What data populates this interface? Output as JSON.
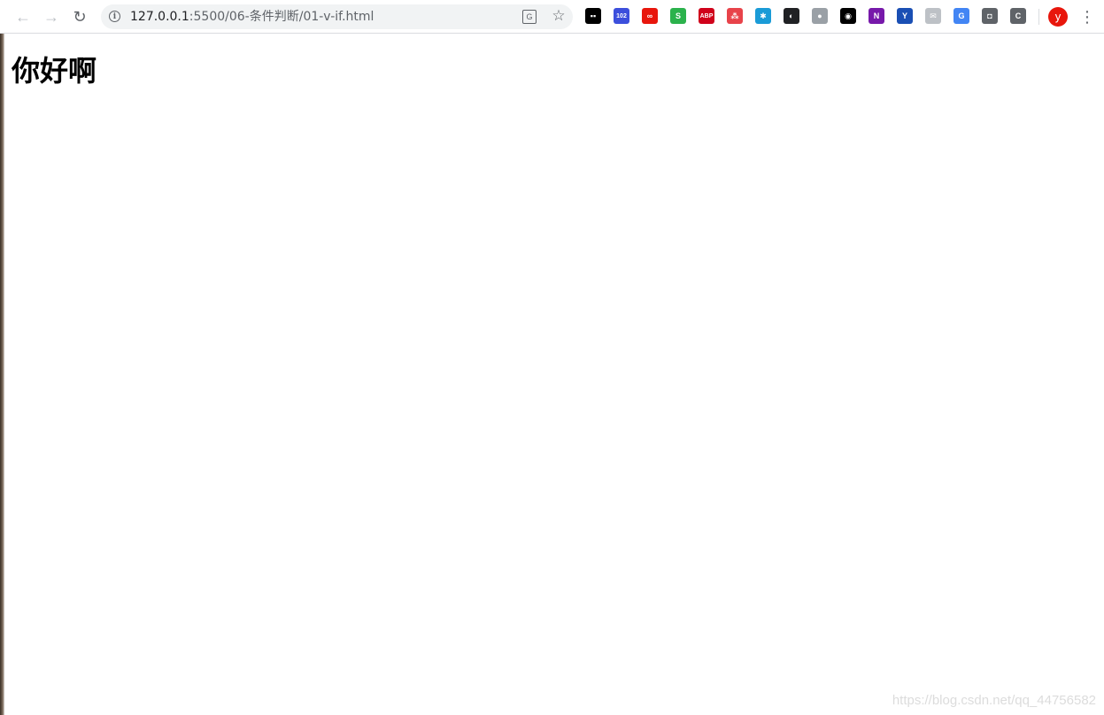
{
  "toolbar": {
    "back_icon": "←",
    "forward_icon": "→",
    "reload_icon": "↻",
    "url_host": "127.0.0.1",
    "url_rest": ":5500/06-条件判断/01-v-if.html",
    "info_icon": "i",
    "translate_icon": "G",
    "star_icon": "☆",
    "avatar_letter": "y",
    "menu_icon": "⋮"
  },
  "extensions": [
    {
      "name": "tampermonkey-icon",
      "glyph": "▪▪",
      "color": "#000000"
    },
    {
      "name": "mail-counter-icon",
      "glyph": "102",
      "color": "#3c4fdc"
    },
    {
      "name": "infinity-icon",
      "glyph": "∞",
      "color": "#e8160c"
    },
    {
      "name": "s-extension-icon",
      "glyph": "S",
      "color": "#2bb24c"
    },
    {
      "name": "adblock-icon",
      "glyph": "ABP",
      "color": "#d0021b"
    },
    {
      "name": "tree-extension-icon",
      "glyph": "⁂",
      "color": "#e8434a"
    },
    {
      "name": "asterisk-icon",
      "glyph": "✱",
      "color": "#1a9bd7"
    },
    {
      "name": "dark-reader-icon",
      "glyph": "◐",
      "color": "#202124"
    },
    {
      "name": "puzzle-extension-icon",
      "glyph": "●",
      "color": "#9aa0a6"
    },
    {
      "name": "ring-extension-icon",
      "glyph": "◉",
      "color": "#000000"
    },
    {
      "name": "onenote-icon",
      "glyph": "N",
      "color": "#7719aa"
    },
    {
      "name": "y-extension-icon",
      "glyph": "Y",
      "color": "#1a4fb4"
    },
    {
      "name": "mail-disabled-icon",
      "glyph": "✉",
      "color": "#bdc1c6"
    },
    {
      "name": "google-translate-icon",
      "glyph": "G",
      "color": "#4285f4"
    },
    {
      "name": "bulb-extension-icon",
      "glyph": "◘",
      "color": "#5f6368"
    },
    {
      "name": "ci-extension-icon",
      "glyph": "C",
      "color": "#5f6368"
    }
  ],
  "page": {
    "heading": "你好啊"
  },
  "watermark": "https://blog.csdn.net/qq_44756582"
}
